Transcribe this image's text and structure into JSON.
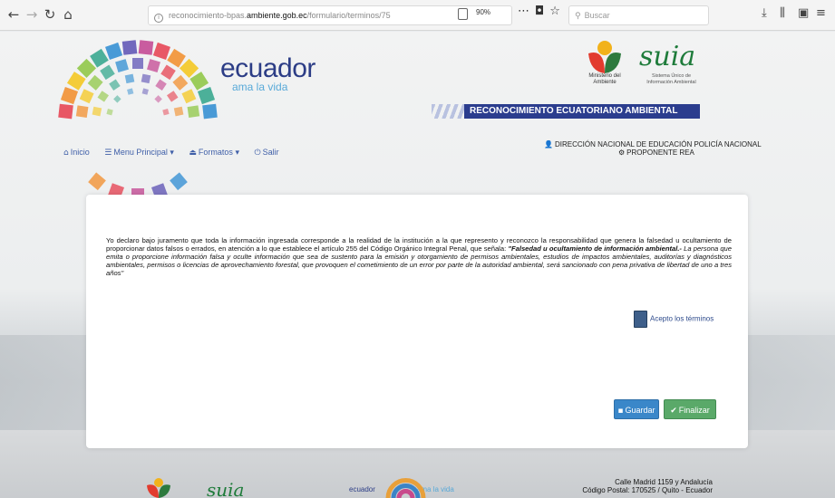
{
  "browser": {
    "url_prefix": "reconocimiento-bpas.",
    "url_host": "ambiente.gob.ec",
    "url_path": "/formulario/terminos/75",
    "zoom": "90%",
    "search_placeholder": "Buscar"
  },
  "header": {
    "brand_main": "ecuador",
    "brand_sub": "ama la vida",
    "ministry_text": "Ministerio del Ambiente",
    "suia_logo": "suia",
    "suia_text": "Sistema Único de Información Ambiental",
    "banner": "RECONOCIMIENTO ECUATORIANO AMBIENTAL"
  },
  "nav": {
    "items": [
      {
        "label": "Inicio",
        "icon": "home-icon"
      },
      {
        "label": "Menu Principal",
        "icon": "list-icon"
      },
      {
        "label": "Formatos",
        "icon": "user-icon"
      },
      {
        "label": "Salir",
        "icon": "power-icon"
      }
    ]
  },
  "user": {
    "line1": "DIRECCIÓN NACIONAL DE EDUCACIÓN POLICÍA NACIONAL",
    "line2": "PROPONENTE REA"
  },
  "declaration": {
    "part1": "Yo declaro bajo juramento que toda la información ingresada corresponde a la realidad de la institución a la que represento y reconozco la responsabilidad que genera la falsedad u ocultamiento de proporcionar datos falsos o errados, en atención a lo que establece el artículo 255 del Código Orgánico Integral Penal, que señala: ",
    "bold": "\"Falsedad u ocultamiento de información ambiental.-",
    "italic": " La persona que emita o proporcione información falsa y oculte información que sea de sustento para la emisión y otorgamiento de permisos ambientales, estudios de impactos ambientales, auditorías y diagnósticos ambientales, permisos o licencias de aprovechamiento forestal, que provoquen el cometimiento de un error por parte de la autoridad ambiental, será sancionado con pena privativa de libertad de uno a tres años\""
  },
  "form": {
    "accept_label": "Acepto los términos",
    "save_label": "Guardar",
    "finish_label": "Finalizar"
  },
  "footer": {
    "suia": "suia",
    "ecuador": "ecuador",
    "ecuador_sub": "ama la vida",
    "address_line1": "Calle Madrid 1159 y Andalucía",
    "address_line2": "Código Postal: 170525 / Quito - Ecuador"
  },
  "colors": {
    "brand_blue": "#2c3d86",
    "banner_blue": "#2b3d8e",
    "save_blue": "#3a87c9",
    "finish_green": "#5aa969",
    "suia_green": "#1e7b3a"
  }
}
